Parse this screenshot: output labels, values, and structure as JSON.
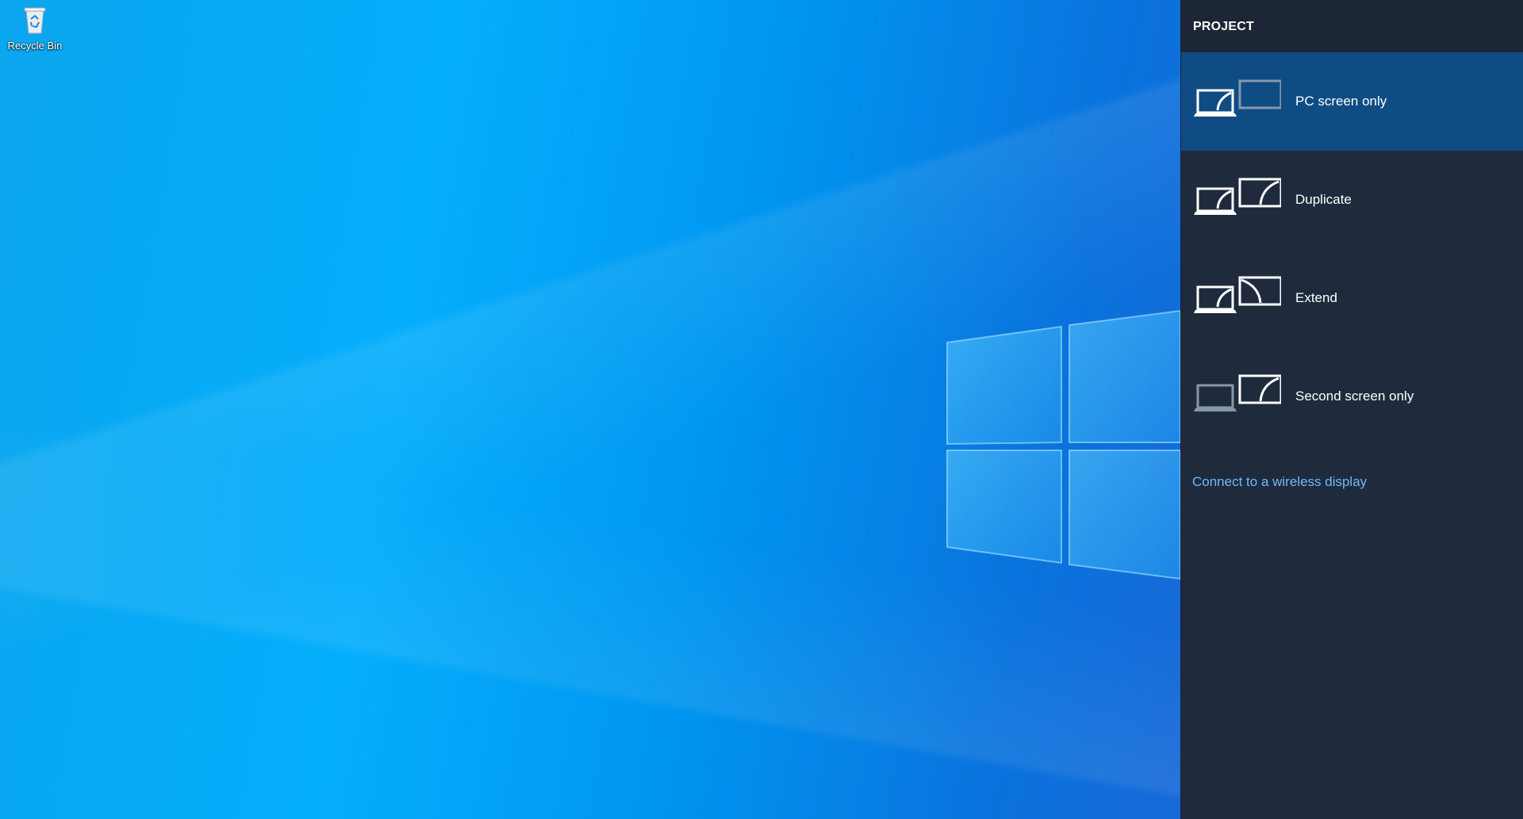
{
  "desktop": {
    "icons": [
      {
        "label": "Recycle Bin",
        "icon": "recycle-bin-icon"
      }
    ]
  },
  "project_panel": {
    "title": "PROJECT",
    "options": [
      {
        "label": "PC screen only",
        "icon": "pc-screen-only-icon",
        "selected": true
      },
      {
        "label": "Duplicate",
        "icon": "duplicate-icon",
        "selected": false
      },
      {
        "label": "Extend",
        "icon": "extend-icon",
        "selected": false
      },
      {
        "label": "Second screen only",
        "icon": "second-screen-only-icon",
        "selected": false
      }
    ],
    "wireless_link": "Connect to a wireless display"
  },
  "colors": {
    "panel_bg": "#1f2b3c",
    "selected_bg": "#0f4c84",
    "link": "#6fb8ff",
    "desktop_accent": "#05aefc"
  }
}
